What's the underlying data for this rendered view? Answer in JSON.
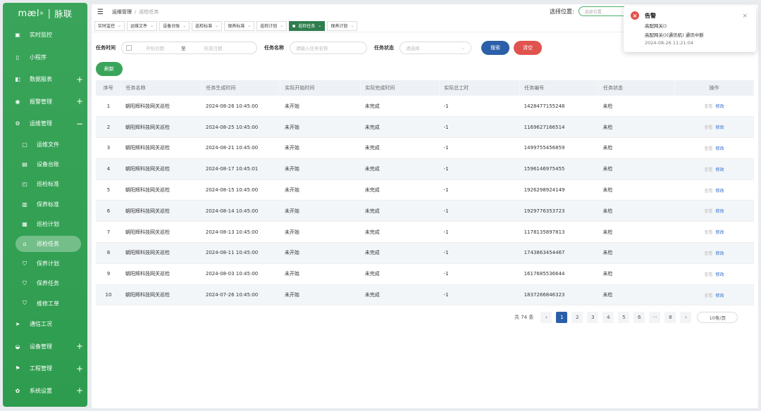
{
  "brand": {
    "logo": "mæl",
    "registered": "®",
    "separator": "|",
    "name_cn": "脉联"
  },
  "sidebar": {
    "items": [
      {
        "label": "实时监控",
        "icon": "image-icon",
        "sub": false,
        "plus": false
      },
      {
        "label": "小程序",
        "icon": "mobile-icon",
        "sub": false,
        "plus": false
      },
      {
        "label": "数据报表",
        "icon": "book-icon",
        "sub": false,
        "plus": true
      },
      {
        "label": "报警管理",
        "icon": "alarm-icon",
        "sub": false,
        "plus": true
      },
      {
        "label": "运维管理",
        "icon": "settings-icon",
        "sub": false,
        "plus": false,
        "minus": true
      },
      {
        "label": "运维文件",
        "icon": "file-icon",
        "sub": true
      },
      {
        "label": "设备台账",
        "icon": "ledger-icon",
        "sub": true
      },
      {
        "label": "巡检标准",
        "icon": "standard-icon",
        "sub": true
      },
      {
        "label": "保养标准",
        "icon": "doc-icon",
        "sub": true
      },
      {
        "label": "巡检计划",
        "icon": "plan-icon",
        "sub": true
      },
      {
        "label": "巡检任务",
        "icon": "task-icon",
        "sub": true,
        "active": true
      },
      {
        "label": "保养计划",
        "icon": "cart-icon",
        "sub": true
      },
      {
        "label": "保养任务",
        "icon": "cart-icon",
        "sub": true
      },
      {
        "label": "维修工单",
        "icon": "cart-icon",
        "sub": true
      },
      {
        "label": "通信工况",
        "icon": "send-icon",
        "sub": false,
        "plus": false
      },
      {
        "label": "设备管理",
        "icon": "device-icon",
        "sub": false,
        "plus": true
      },
      {
        "label": "工程管理",
        "icon": "flag-icon",
        "sub": false,
        "plus": true
      },
      {
        "label": "系统设置",
        "icon": "gear-icon",
        "sub": false,
        "plus": true
      }
    ]
  },
  "topbar": {
    "crumb1": "运维管理",
    "crumb_sep": "/",
    "crumb2": "巡检任务",
    "location_label": "选择位置:",
    "location_placeholder": "选择位置"
  },
  "tabs": [
    {
      "label": "实时监控",
      "active": false
    },
    {
      "label": "运维文件",
      "active": false
    },
    {
      "label": "设备台账",
      "active": false
    },
    {
      "label": "巡检标准",
      "active": false
    },
    {
      "label": "保养标准",
      "active": false
    },
    {
      "label": "巡检计划",
      "active": false
    },
    {
      "label": "巡检任务",
      "active": true
    },
    {
      "label": "保养计划",
      "active": false
    }
  ],
  "filter": {
    "time_label": "任务时间",
    "start_placeholder": "开始日期",
    "to": "至",
    "end_placeholder": "结束日期",
    "name_label": "任务名称",
    "name_placeholder": "请输入任务名称",
    "status_label": "任务状态",
    "status_placeholder": "请选择",
    "search": "搜索",
    "clear": "清空",
    "refresh": "刷新"
  },
  "table": {
    "headers": [
      "序号",
      "任务名称",
      "任务生成时间",
      "实际开始时间",
      "实际完成时间",
      "实际总工时",
      "任务编号",
      "任务状态",
      "操作"
    ],
    "rows": [
      [
        "1",
        "朝阳辉科技网关巡检",
        "2024-08-26 10:45:00",
        "未开始",
        "未完成",
        "-1",
        "1428477155248",
        "未检"
      ],
      [
        "2",
        "朝阳辉科技网关巡检",
        "2024-08-25 10:45:00",
        "未开始",
        "未完成",
        "-1",
        "1169627166514",
        "未检"
      ],
      [
        "3",
        "朝阳辉科技网关巡检",
        "2024-08-21 10:45:00",
        "未开始",
        "未完成",
        "-1",
        "1499755456859",
        "未检"
      ],
      [
        "4",
        "朝阳辉科技网关巡检",
        "2024-08-17 10:45:01",
        "未开始",
        "未完成",
        "-1",
        "1596146975455",
        "未检"
      ],
      [
        "5",
        "朝阳辉科技网关巡检",
        "2024-08-15 10:45:00",
        "未开始",
        "未完成",
        "-1",
        "1926298924149",
        "未检"
      ],
      [
        "6",
        "朝阳辉科技网关巡检",
        "2024-08-14 10:45:00",
        "未开始",
        "未完成",
        "-1",
        "1929776353723",
        "未检"
      ],
      [
        "7",
        "朝阳辉科技网关巡检",
        "2024-08-13 10:45:00",
        "未开始",
        "未完成",
        "-1",
        "1178135897813",
        "未检"
      ],
      [
        "8",
        "朝阳辉科技网关巡检",
        "2024-08-11 10:45:00",
        "未开始",
        "未完成",
        "-1",
        "1743863454467",
        "未检"
      ],
      [
        "9",
        "朝阳辉科技网关巡检",
        "2024-08-03 10:45:00",
        "未开始",
        "未完成",
        "-1",
        "1617685536644",
        "未检"
      ],
      [
        "10",
        "朝阳辉科技网关巡检",
        "2024-07-26 10:45:00",
        "未开始",
        "未完成",
        "-1",
        "1837266846323",
        "未检"
      ]
    ],
    "op_delete": "查看",
    "op_edit": "修改"
  },
  "pager": {
    "total": "共 74 条",
    "prev": "‹",
    "next": "›",
    "pages": [
      "1",
      "2",
      "3",
      "4",
      "5",
      "6",
      "···",
      "8"
    ],
    "current": "1",
    "page_size": "10条/页"
  },
  "alert": {
    "title": "告警",
    "line1": "高配网关()",
    "line2": "高配网关()(通讯机) 通讯中断",
    "time": "2024-08-26 11:21:04",
    "close": "×"
  },
  "colors": {
    "sidebar": "#3aa55a",
    "active_tab": "#2f7d4d",
    "search_btn": "#2b5fa8",
    "clear_btn": "#e0534e",
    "link": "#2b6bd1"
  }
}
